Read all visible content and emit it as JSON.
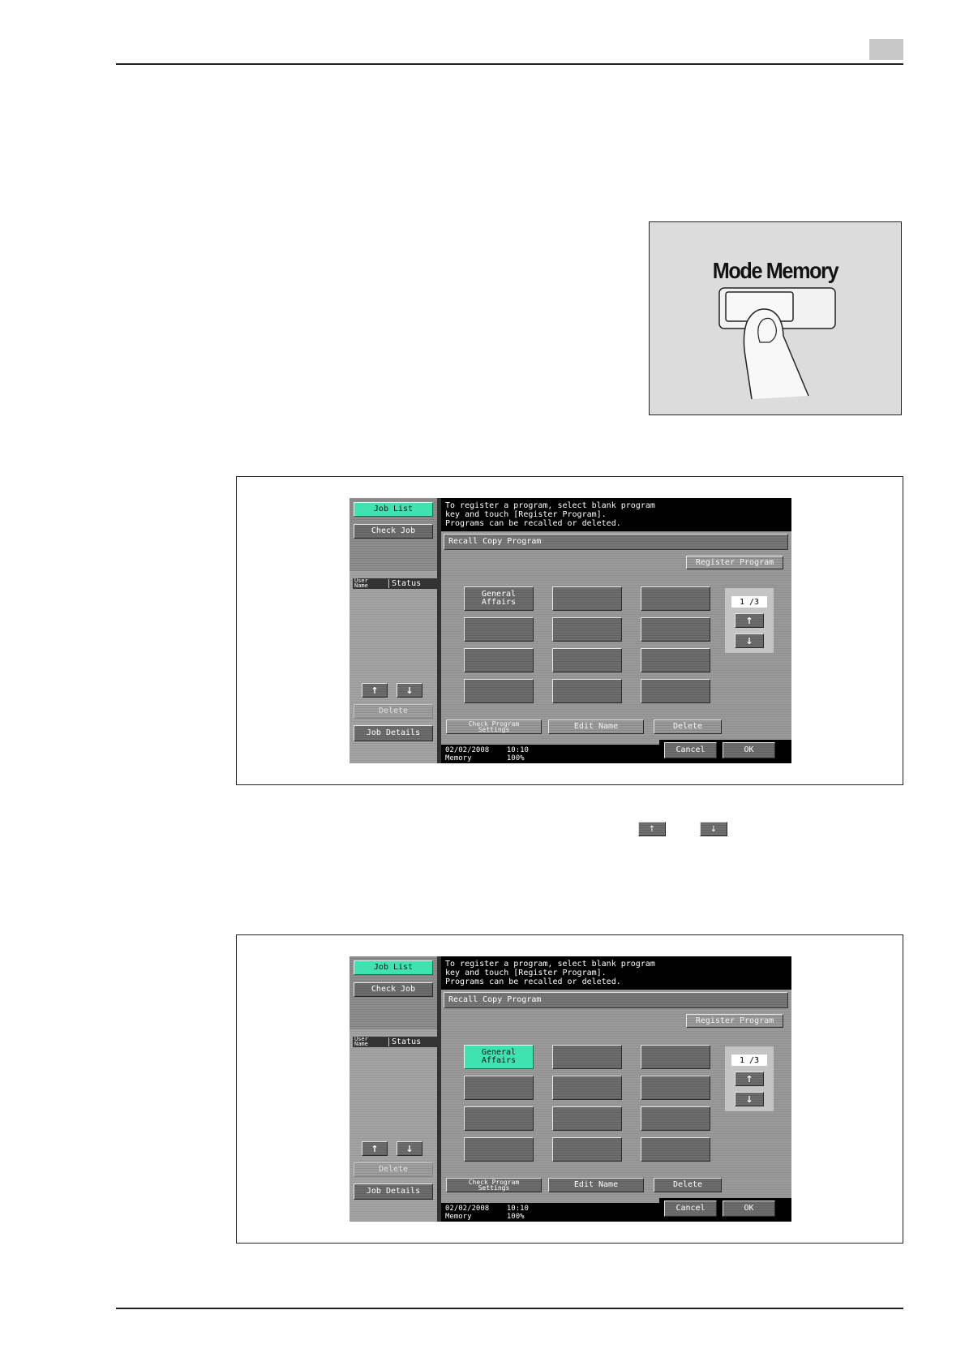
{
  "illustration": {
    "key_label": "Mode Memory"
  },
  "screens": [
    {
      "job_list": "Job List",
      "check_job": "Check Job",
      "col_user_name": "User\nName",
      "col_status": "Status",
      "delete_left": "Delete",
      "job_details": "Job Details",
      "message": "To register a program, select blank program\nkey and touch [Register Program].\nPrograms can be recalled or deleted.",
      "title": "Recall Copy Program",
      "register_program": "Register Program",
      "program_1": "General\nAffairs",
      "page_indicator": "1 /3",
      "check_program_settings": "Check Program\nSettings",
      "edit_name": "Edit Name",
      "delete_bottom": "Delete",
      "footer": "02/02/2008    10:10\nMemory        100%",
      "cancel": "Cancel",
      "ok": "OK",
      "up_arrow": "↑",
      "down_arrow": "↓"
    },
    {
      "job_list": "Job List",
      "check_job": "Check Job",
      "col_user_name": "User\nName",
      "col_status": "Status",
      "delete_left": "Delete",
      "job_details": "Job Details",
      "message": "To register a program, select blank program\nkey and touch [Register Program].\nPrograms can be recalled or deleted.",
      "title": "Recall Copy Program",
      "register_program": "Register Program",
      "program_1": "General\nAffairs",
      "page_indicator": "1 /3",
      "check_program_settings": "Check Program\nSettings",
      "edit_name": "Edit Name",
      "delete_bottom": "Delete",
      "footer": "02/02/2008    10:10\nMemory        100%",
      "cancel": "Cancel",
      "ok": "OK",
      "up_arrow": "↑",
      "down_arrow": "↓"
    }
  ],
  "inline_icons": {
    "up": "↑",
    "down": "↓"
  },
  "colors": {
    "selected_green": "#3fe3b0",
    "panel_gray": "#9a9a9a"
  }
}
